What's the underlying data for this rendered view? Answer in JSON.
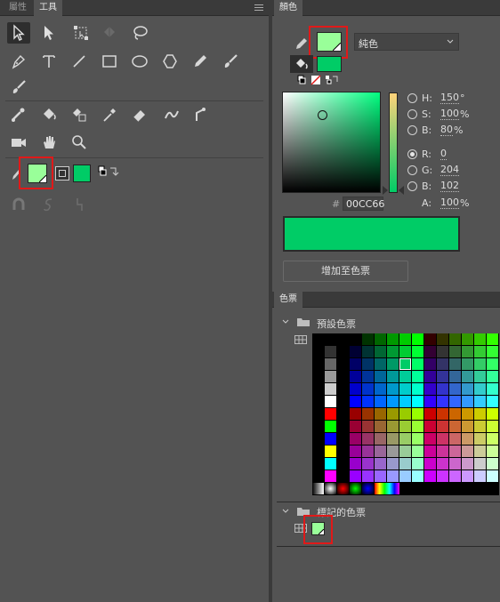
{
  "left_tabs": [
    "屬性",
    "工具"
  ],
  "right_tab": "顏色",
  "color": {
    "fill_type": "純色",
    "fill_color": "#99ff99",
    "stroke_color": "#00cc66",
    "labels": {
      "h": "H:",
      "s": "S:",
      "b": "B:",
      "r": "R:",
      "g": "G:",
      "bb": "B:",
      "a": "A:"
    },
    "h": "150",
    "h_unit": "°",
    "s": "100",
    "s_unit": "%",
    "b": "80",
    "b_unit": "%",
    "r": "0",
    "g": "204",
    "blue": "102",
    "a": "100",
    "a_unit": "%",
    "hash": "#",
    "hex": "00CC66",
    "preview": "#00cc66",
    "add_button": "增加至色票"
  },
  "swatches_panel": {
    "title": "色票",
    "group1": "預設色票",
    "group2": "標記的色票"
  },
  "icons": [
    "arrow-icon",
    "subselect-icon",
    "free-transform-icon",
    "3d-rotation-icon",
    "lasso-icon",
    "pen-icon",
    "text-icon",
    "line-icon",
    "rectangle-icon",
    "oval-icon",
    "polystar-icon",
    "pencil-icon",
    "brush-icon",
    "paintbrush-icon",
    "bone-icon",
    "paint-bucket-icon",
    "ink-bottle-icon",
    "eyedropper-icon",
    "eraser-icon",
    "width-icon",
    "asset-warp-icon",
    "camera-icon",
    "hand-icon",
    "zoom-icon",
    "magnet-icon",
    "smooth-icon",
    "straighten-icon"
  ]
}
